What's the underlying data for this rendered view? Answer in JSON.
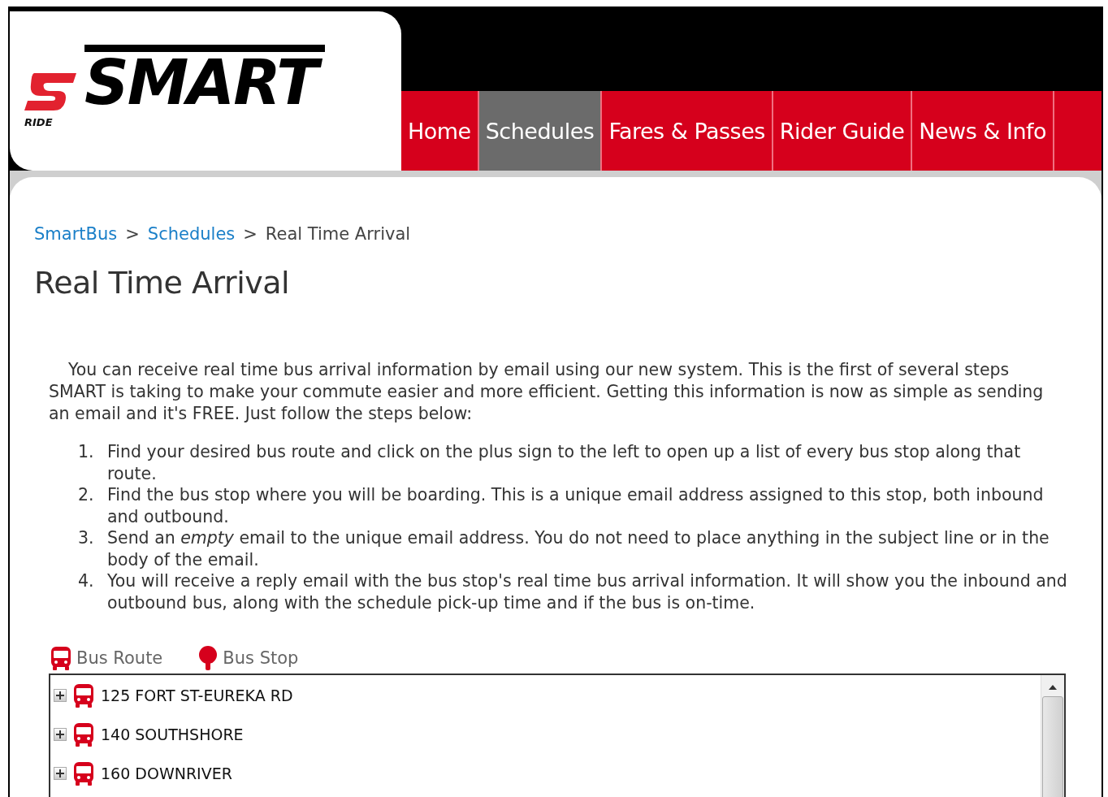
{
  "logo": {
    "small": "RIDE",
    "big": "SMART"
  },
  "nav": [
    {
      "label": "Home",
      "selected": false
    },
    {
      "label": "Schedules",
      "selected": true
    },
    {
      "label": "Fares & Passes",
      "selected": false
    },
    {
      "label": "Rider Guide",
      "selected": false
    },
    {
      "label": "News & Info",
      "selected": false
    }
  ],
  "breadcrumb": [
    {
      "label": "SmartBus",
      "link": true
    },
    {
      "label": "Schedules",
      "link": true
    },
    {
      "label": "Real Time Arrival",
      "link": false
    }
  ],
  "breadcrumb_separator": ">",
  "title": "Real Time Arrival",
  "intro": "You can receive real time bus arrival information by email using our new system.  This is the first of several steps SMART is taking to make your commute easier and more efficient. Getting this information is now as simple as sending an email and it's FREE.  Just follow the steps below:",
  "steps": [
    {
      "number": "1.",
      "text": "Find your desired bus route and click on the plus sign to the left to open up a list of every bus stop along that route."
    },
    {
      "number": "2.",
      "text": "Find the bus stop where you will be boarding.  This is a unique email address assigned to this stop, both inbound and outbound."
    },
    {
      "number": "3.",
      "text": "Send an *empty* email to the unique email address. You do not need to place anything in the subject line or in the body of the email."
    },
    {
      "number": "4.",
      "text": "You will receive a reply email with the bus stop's real time bus arrival information.  It will show you the inbound and outbound bus, along with the schedule pick-up time and if the bus is on-time."
    }
  ],
  "legend": [
    {
      "kind": "route",
      "label": "Bus Route"
    },
    {
      "kind": "stop",
      "label": "Bus Stop"
    }
  ],
  "routes": [
    {
      "label": "125 FORT ST-EUREKA RD",
      "expanded": false
    },
    {
      "label": "140 SOUTHSHORE",
      "expanded": false
    },
    {
      "label": "160 DOWNRIVER",
      "expanded": false
    }
  ]
}
